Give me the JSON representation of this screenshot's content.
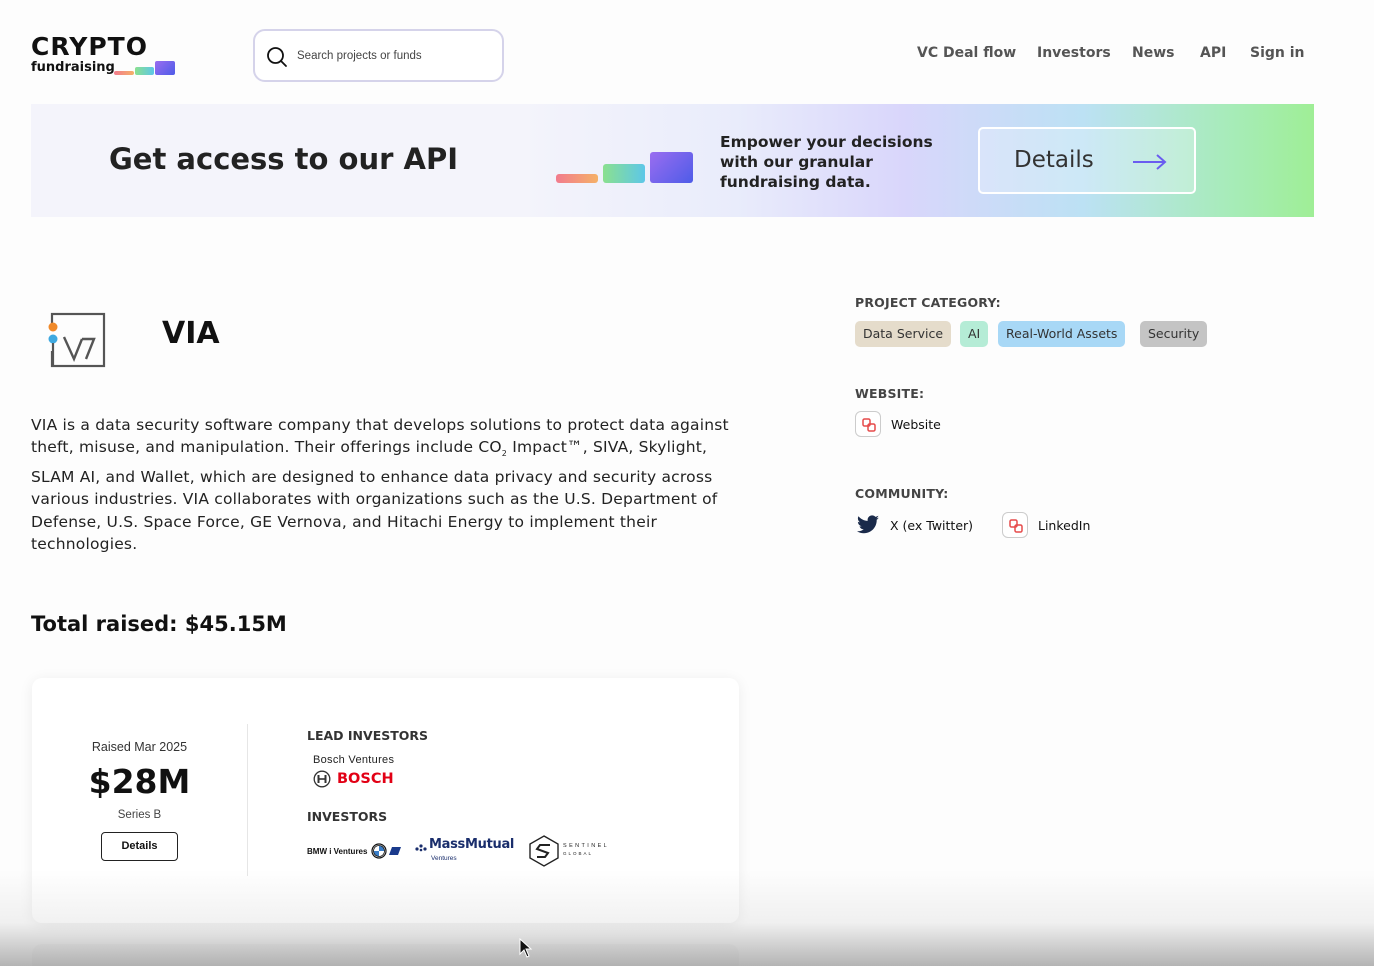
{
  "header": {
    "logo_title": "CRYPTO",
    "logo_sub": "fundraising",
    "search_placeholder": "Search projects or funds",
    "nav": [
      {
        "label": "VC Deal flow"
      },
      {
        "label": "Investors"
      },
      {
        "label": "News"
      },
      {
        "label": "API"
      },
      {
        "label": "Sign in"
      }
    ]
  },
  "banner": {
    "title": "Get access to our API",
    "text": "Empower your decisions with our granular fundraising data.",
    "button_label": "Details"
  },
  "project": {
    "name": "VIA",
    "description_part1": "VIA is a data security software company that develops solutions to protect data against theft, misuse, and manipulation. Their offerings include CO",
    "description_sub": "2",
    "description_part2": " Impact™, SIVA, Skylight, SLAM AI, and Wallet, which are designed to enhance data privacy and security across various industries. VIA collaborates with organizations such as the U.S. Department of Defense, U.S. Space Force, GE Vernova, and Hitachi Energy to implement their technologies.",
    "total_raised": "Total raised: $45.15M"
  },
  "sidebar": {
    "category_label": "PROJECT CATEGORY:",
    "categories": [
      {
        "label": "Data Service",
        "color": "#e5dccb"
      },
      {
        "label": "AI",
        "color": "#b5ecd6"
      },
      {
        "label": "Real-World Assets",
        "color": "#a8d8f6"
      },
      {
        "label": "Security",
        "color": "#c4c4c4"
      }
    ],
    "website_label": "WEBSITE:",
    "website_link": "Website",
    "community_label": "COMMUNITY:",
    "community_links": [
      {
        "label": "X (ex Twitter)",
        "icon": "twitter-icon"
      },
      {
        "label": "LinkedIn",
        "icon": "link-icon"
      }
    ]
  },
  "funding_round": {
    "date": "Raised Mar 2025",
    "amount": "$28M",
    "round": "Series B",
    "details_label": "Details",
    "lead_investors_label": "LEAD INVESTORS",
    "lead_investor_name": "Bosch Ventures",
    "lead_investor_logo": "BOSCH",
    "investors_label": "INVESTORS",
    "investor_logos": [
      {
        "text": "BMW i Ventures"
      },
      {
        "text": "MassMutual",
        "sub": "Ventures"
      },
      {
        "text": "SENTINEL",
        "sub": "GLOBAL"
      }
    ]
  },
  "colors": {
    "accent_purple": "#6a5cf0",
    "bosch_red": "#e20015"
  }
}
